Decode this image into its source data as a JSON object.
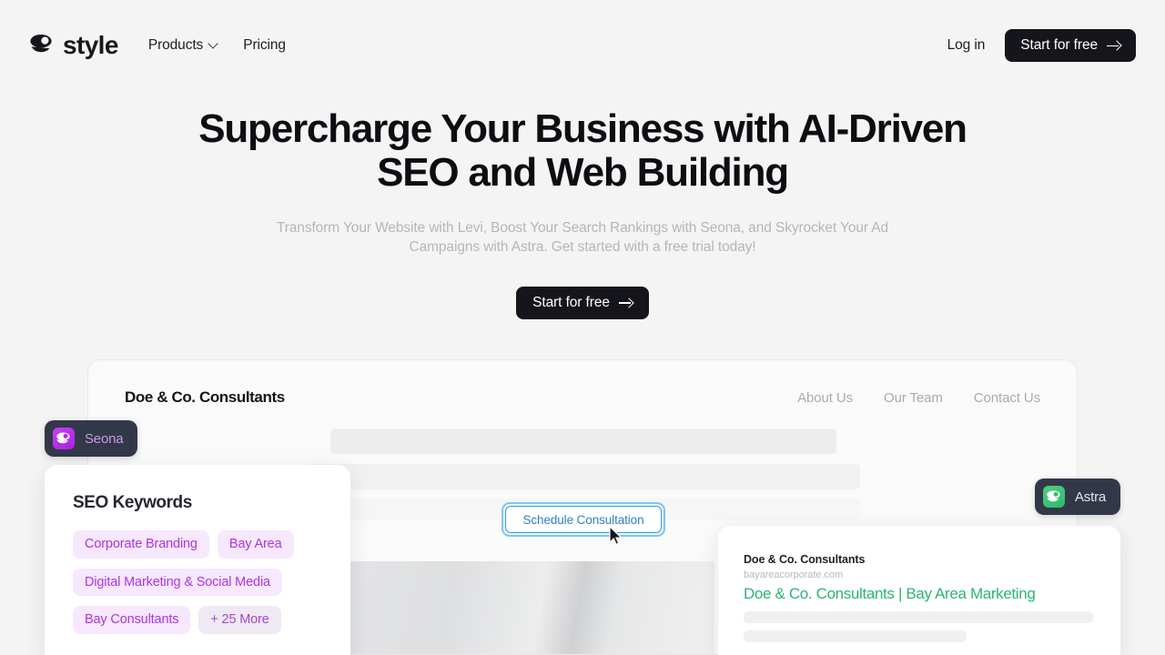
{
  "nav": {
    "logo_word": "style",
    "logo_icon": "style-smiley-logo-icon",
    "links": [
      {
        "label": "Products",
        "has_dropdown": true
      },
      {
        "label": "Pricing",
        "has_dropdown": false
      }
    ],
    "login_label": "Log in",
    "cta_label": "Start for free"
  },
  "hero": {
    "heading": "Supercharge Your Business with AI-Driven SEO and Web Building",
    "subheading": "Transform Your Website with Levi, Boost Your Search Rankings with Seona, and Skyrocket Your Ad Campaigns with Astra. Get started with a free trial today!",
    "cta_label": "Start for free"
  },
  "mock_site": {
    "brand": "Doe & Co. Consultants",
    "links": [
      "About Us",
      "Our Team",
      "Contact Us"
    ],
    "schedule_button": "Schedule Consultation"
  },
  "seona": {
    "badge_label": "Seona",
    "card_title": "SEO Keywords",
    "keywords": [
      {
        "label": "Corporate Branding",
        "muted": false
      },
      {
        "label": "Bay Area",
        "muted": false
      },
      {
        "label": "Digital Marketing & Social Media",
        "muted": false
      },
      {
        "label": "Bay Consultants",
        "muted": false
      },
      {
        "label": "+ 25 More",
        "muted": true
      }
    ]
  },
  "astra": {
    "badge_label": "Astra"
  },
  "search_result": {
    "business": "Doe & Co. Consultants",
    "url": "bayareacorporate.com",
    "headline": "Doe & Co. Consultants | Bay Area Marketing"
  },
  "colors": {
    "page_bg": "#f4f4f4",
    "dark_button": "#15161b",
    "seona_purple": "#ab35e0",
    "astra_green": "#2bb573",
    "badge_bg": "#333848",
    "link_blue": "#2e7fc0",
    "focus_ring": "#7cc8ea"
  }
}
